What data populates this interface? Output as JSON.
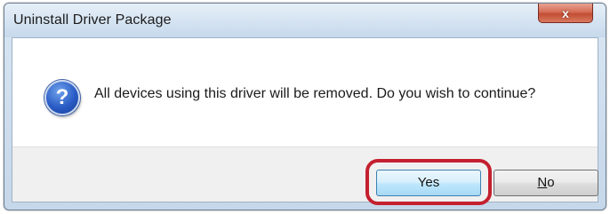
{
  "window": {
    "title": "Uninstall Driver Package",
    "close_icon": "close-icon",
    "close_glyph": "x"
  },
  "message": {
    "icon": "question-icon",
    "icon_glyph": "?",
    "text": "All devices using this driver will be removed.  Do you wish to continue?"
  },
  "buttons": {
    "yes_label": "Yes",
    "no_label_mnemonic": "N",
    "no_label_rest": "o"
  },
  "annotation": {
    "highlight_color": "#c4202f",
    "highlighted": "yes-button"
  }
}
